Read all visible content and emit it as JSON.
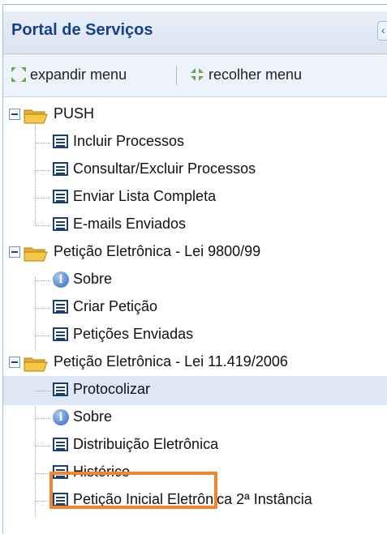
{
  "panel": {
    "title": "Portal de Serviços"
  },
  "toolbar": {
    "expand_label": "expandir menu",
    "collapse_label": "recolher menu"
  },
  "tree": {
    "groups": [
      {
        "label": "PUSH",
        "items": [
          {
            "label": "Incluir Processos",
            "icon": "document-icon"
          },
          {
            "label": "Consultar/Excluir Processos",
            "icon": "document-icon"
          },
          {
            "label": "Enviar Lista Completa",
            "icon": "document-icon"
          },
          {
            "label": "E-mails Enviados",
            "icon": "document-icon"
          }
        ]
      },
      {
        "label": "Petição Eletrônica - Lei 9800/99",
        "items": [
          {
            "label": "Sobre",
            "icon": "info-icon"
          },
          {
            "label": "Criar Petição",
            "icon": "document-icon"
          },
          {
            "label": "Petições Enviadas",
            "icon": "document-icon"
          }
        ]
      },
      {
        "label": "Petição Eletrônica - Lei 11.419/2006",
        "items": [
          {
            "label": "Protocolizar",
            "icon": "document-icon",
            "selected": true
          },
          {
            "label": "Sobre",
            "icon": "info-icon"
          },
          {
            "label": "Distribuição Eletrônica",
            "icon": "document-icon"
          },
          {
            "label": "Histórico",
            "icon": "document-icon",
            "highlighted": true
          },
          {
            "label": "Petição Inicial Eletrônica 2ª Instância",
            "icon": "document-icon"
          }
        ]
      }
    ]
  },
  "colors": {
    "header_text": "#15428b",
    "selected_row": "#dde7f6",
    "highlight_box": "#f0862d",
    "folder": "#f6c84a"
  }
}
